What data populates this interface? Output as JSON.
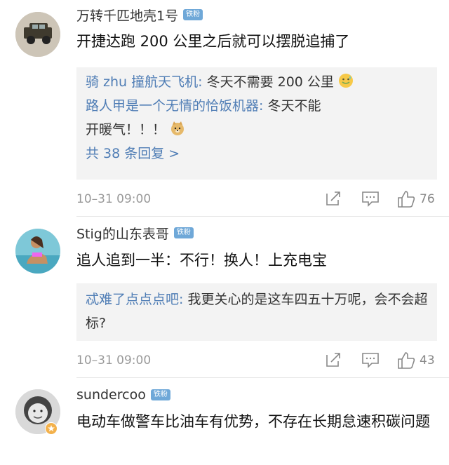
{
  "comments": [
    {
      "username": "万转千匹地壳1号",
      "badge": "铁粉",
      "text": "开捷达跑 200 公里之后就可以摆脱追捕了",
      "replies": [
        {
          "who": "骑 zhu 撞航天飞机:",
          "text": " 冬天不需要 200 公里",
          "emoji": "sweat-smile-emoji"
        },
        {
          "who": "路人甲是一个无情的恰饭机器:",
          "text": " 冬天不能开暖气！！！",
          "emoji": "doge-emoji"
        }
      ],
      "more": "共 38 条回复 >",
      "time": "10–31 09:00",
      "likes": "76"
    },
    {
      "username": "Stig的山东表哥",
      "badge": "铁粉",
      "text": "追人追到一半：不行！换人！上充电宝",
      "replies": [
        {
          "who": "忒难了点点点吧:",
          "text": " 我更关心的是这车四五十万呢，会不会超标?"
        }
      ],
      "time": "10–31 09:00",
      "likes": "43"
    },
    {
      "username": "sundercoo",
      "badge": "铁粉",
      "text": "电动车做警车比油车有优势，不存在长期怠速积碳问题"
    }
  ],
  "colors": {
    "link": "#4f7db5",
    "badge": "#6fa8d8",
    "reply_bg": "#f3f3f3"
  },
  "icons": [
    "share-icon",
    "comment-icon",
    "like-icon"
  ]
}
